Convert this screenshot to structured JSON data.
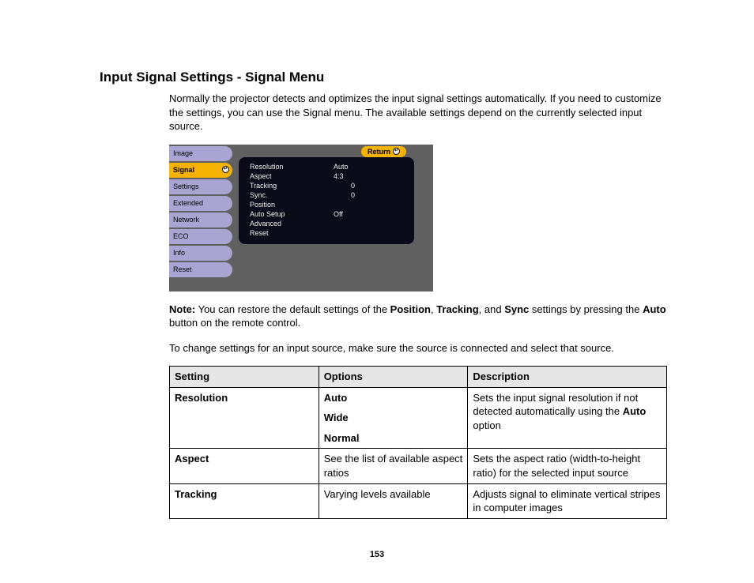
{
  "title": "Input Signal Settings - Signal Menu",
  "intro": "Normally the projector detects and optimizes the input signal settings automatically. If you need to customize the settings, you can use the Signal menu. The available settings depend on the currently selected input source.",
  "osd": {
    "return": "Return",
    "tabs": [
      "Image",
      "Signal",
      "Settings",
      "Extended",
      "Network",
      "ECO",
      "Info",
      "Reset"
    ],
    "activeTab": "Signal",
    "items": [
      {
        "label": "Resolution",
        "value": "Auto"
      },
      {
        "label": "Aspect",
        "value": "4:3"
      },
      {
        "label": "Tracking",
        "value": "0"
      },
      {
        "label": "Sync.",
        "value": "0"
      },
      {
        "label": "Position",
        "value": ""
      },
      {
        "label": "Auto Setup",
        "value": "Off"
      },
      {
        "label": "Advanced",
        "value": ""
      },
      {
        "label": "Reset",
        "value": ""
      }
    ]
  },
  "note": {
    "label": "Note:",
    "t1": " You can restore the default settings of the ",
    "b1": "Position",
    "t2": ", ",
    "b2": "Tracking",
    "t3": ", and ",
    "b3": "Sync",
    "t4": " settings by pressing the ",
    "b4": "Auto",
    "t5": " button on the remote control."
  },
  "instruction": "To change settings for an input source, make sure the source is connected and select that source.",
  "table": {
    "headers": [
      "Setting",
      "Options",
      "Description"
    ],
    "rows": [
      {
        "setting": "Resolution",
        "options": [
          "Auto",
          "Wide",
          "Normal"
        ],
        "optionsBold": true,
        "desc_pre": "Sets the input signal resolution if not detected automatically using the ",
        "desc_b": "Auto",
        "desc_post": " option"
      },
      {
        "setting": "Aspect",
        "optionsText": "See the list of available aspect ratios",
        "desc": "Sets the aspect ratio (width-to-height ratio) for the selected input source"
      },
      {
        "setting": "Tracking",
        "optionsText": "Varying levels available",
        "desc": "Adjusts signal to eliminate vertical stripes in computer images"
      }
    ]
  },
  "pageNumber": "153"
}
